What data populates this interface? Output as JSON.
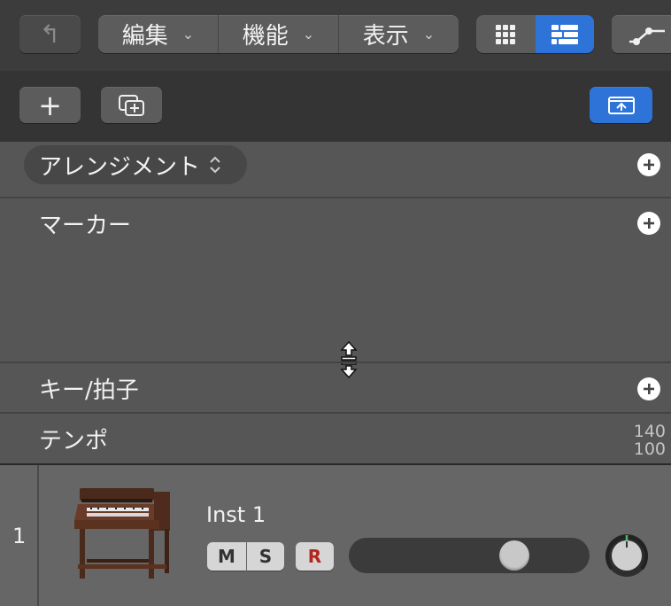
{
  "toolbar": {
    "back_glyph": "↰",
    "menus": [
      {
        "label": "編集"
      },
      {
        "label": "機能"
      },
      {
        "label": "表示"
      }
    ],
    "chevron": "⌄"
  },
  "toolbar2": {
    "add_glyph": "+"
  },
  "global_tracks": {
    "arrangement_label": "アレンジメント",
    "arrangement_stepper": "⌃⌄",
    "marker_label": "マーカー",
    "signature_label": "キー/拍子",
    "tempo_label": "テンポ",
    "tempo_max": "140",
    "tempo_min": "100"
  },
  "track": {
    "number": "1",
    "name": "Inst 1",
    "mute_label": "M",
    "solo_label": "S",
    "record_label": "R",
    "volume_fraction": 0.72
  },
  "colors": {
    "accent": "#2d73d8",
    "record": "#b3261e"
  }
}
